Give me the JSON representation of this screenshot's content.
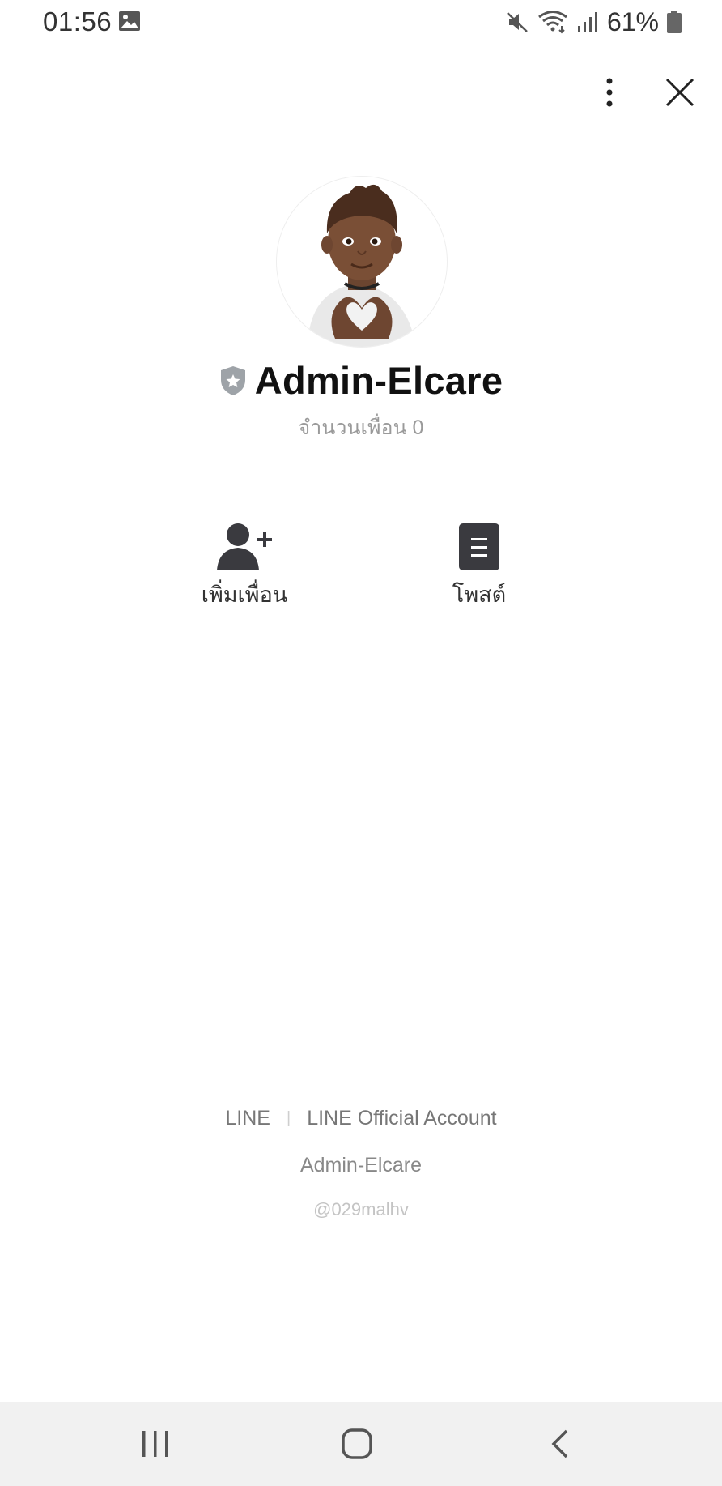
{
  "status_bar": {
    "time": "01:56",
    "battery": "61%"
  },
  "icons": {
    "gallery": "image-icon",
    "mute": "mute-icon",
    "wifi": "wifi-icon",
    "signal": "signal-icon",
    "battery": "battery-icon",
    "more": "more-vertical-icon",
    "close": "close-icon",
    "official_badge": "shield-star-icon",
    "add_friend": "add-person-icon",
    "post": "document-icon"
  },
  "profile": {
    "name": "Admin-Elcare",
    "friend_count_label": "จำนวนเพื่อน 0"
  },
  "actions": {
    "add_friend_label": "เพิ่มเพื่อน",
    "post_label": "โพสต์"
  },
  "footer": {
    "link_line": "LINE",
    "link_official": "LINE Official Account",
    "account_name": "Admin-Elcare",
    "account_id": "@029malhv"
  },
  "colors": {
    "icon_dark": "#3a3a3f",
    "badge_gray": "#9ea3a8",
    "nav_bg": "#f1f1f1"
  }
}
